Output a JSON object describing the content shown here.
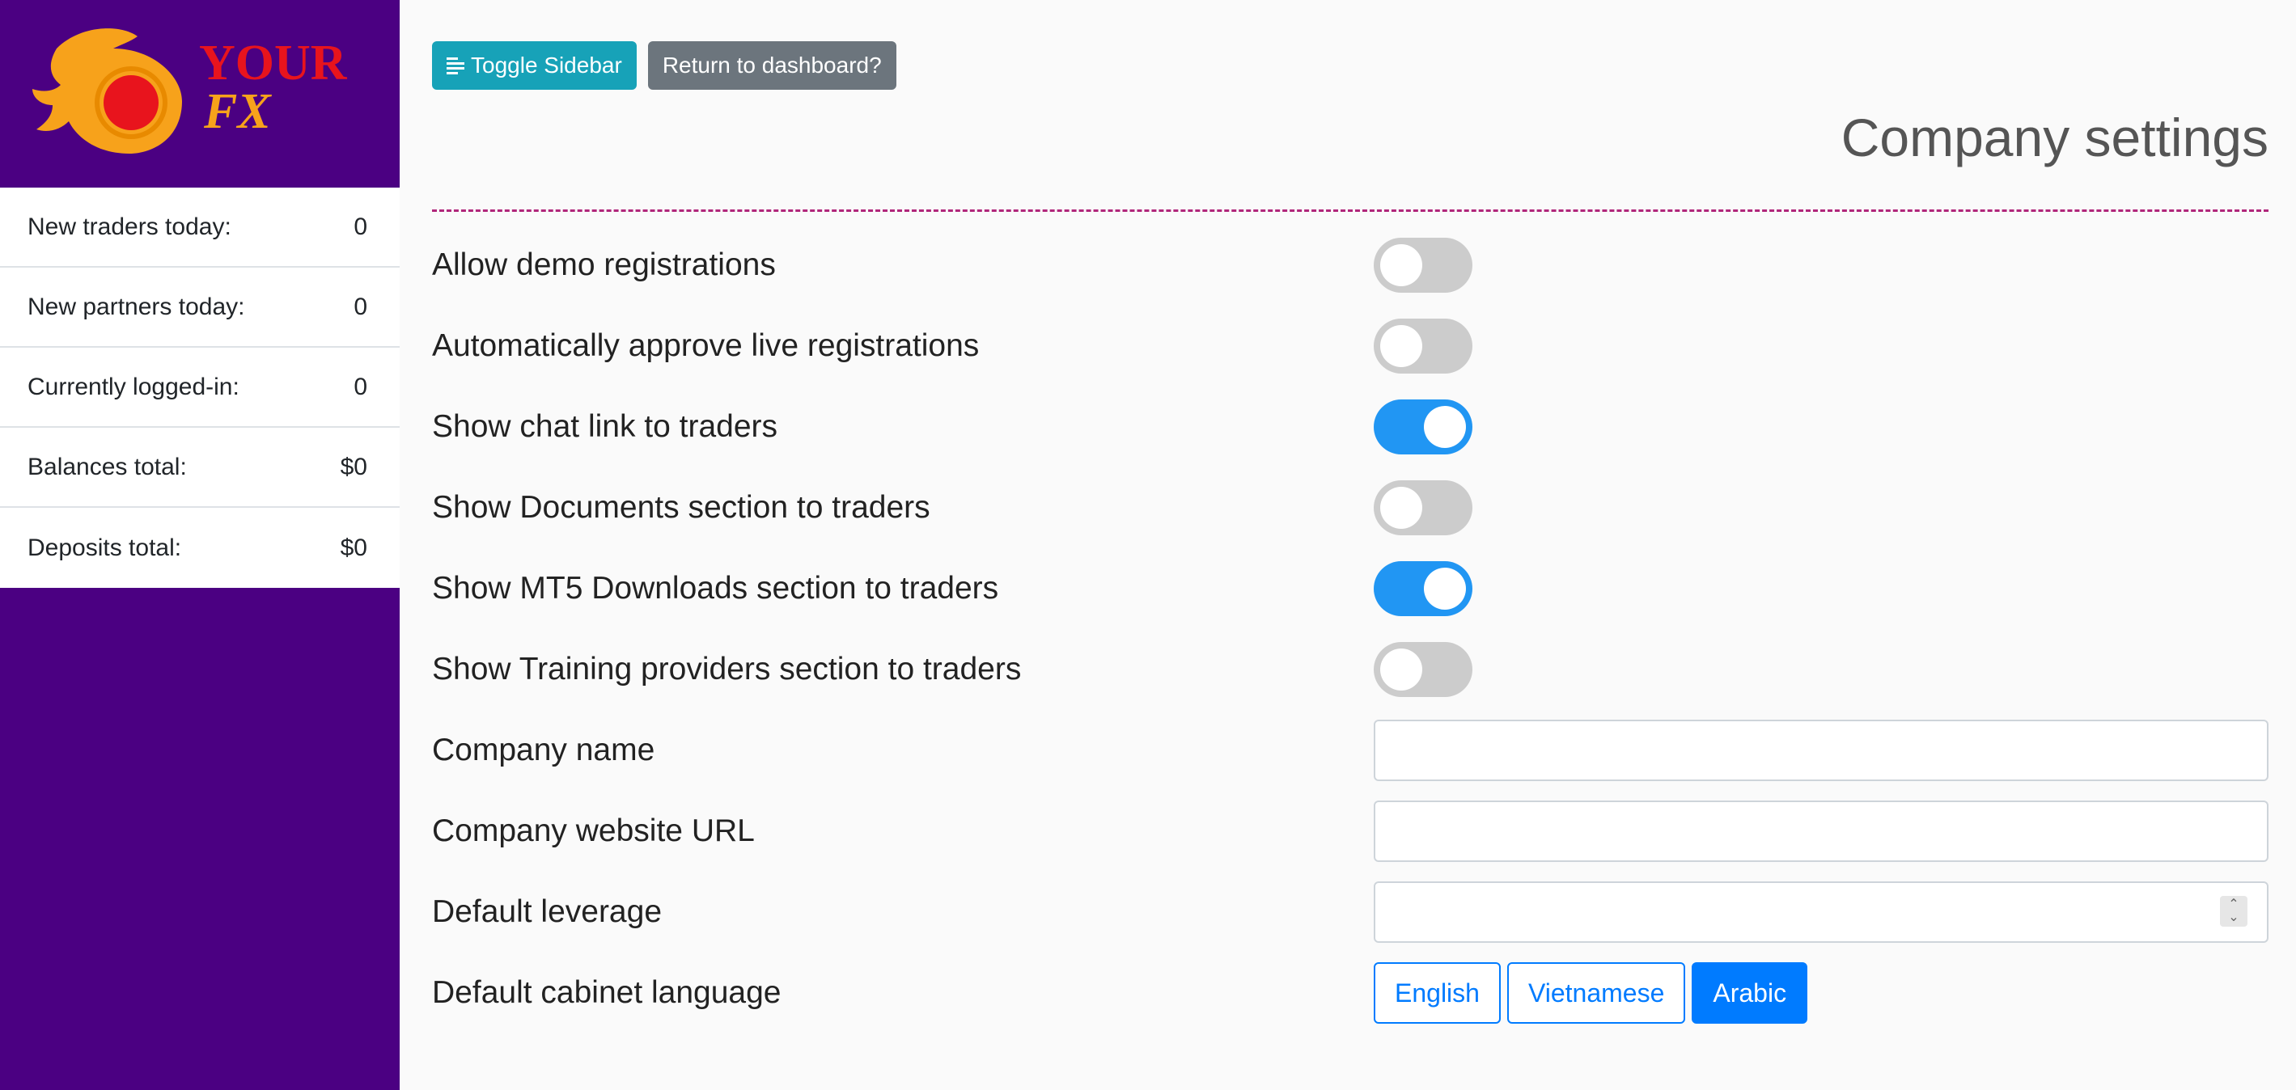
{
  "brand": {
    "logo_text_line1": "YOUR",
    "logo_text_line2": "FX",
    "colors": {
      "sidebar_bg": "#4b0082",
      "logo_orange": "#f7a21b",
      "logo_red": "#e8141d",
      "accent_blue": "#2196f3",
      "info": "#17a2b8",
      "secondary": "#6c757d",
      "primary": "#007bff"
    }
  },
  "sidebar": {
    "stats": [
      {
        "label": "New traders today:",
        "value": "0"
      },
      {
        "label": "New partners today:",
        "value": "0"
      },
      {
        "label": "Currently logged-in:",
        "value": "0"
      },
      {
        "label": "Balances total:",
        "value": "$0"
      },
      {
        "label": "Deposits total:",
        "value": "$0"
      }
    ]
  },
  "toolbar": {
    "toggle_sidebar_label": "Toggle Sidebar",
    "toggle_sidebar_icon": "menu-lines-icon",
    "return_label": "Return to dashboard?"
  },
  "page": {
    "title": "Company settings"
  },
  "settings": {
    "toggles": [
      {
        "label": "Allow demo registrations",
        "on": false
      },
      {
        "label": "Automatically approve live registrations",
        "on": false
      },
      {
        "label": "Show chat link to traders",
        "on": true
      },
      {
        "label": "Show Documents section to traders",
        "on": false
      },
      {
        "label": "Show MT5 Downloads section to traders",
        "on": true
      },
      {
        "label": "Show Training providers section to traders",
        "on": false
      }
    ],
    "company_name": {
      "label": "Company name",
      "value": ""
    },
    "company_website": {
      "label": "Company website URL",
      "value": ""
    },
    "default_leverage": {
      "label": "Default leverage",
      "value": ""
    },
    "default_language": {
      "label": "Default cabinet language",
      "options": [
        "English",
        "Vietnamese",
        "Arabic"
      ],
      "selected": "Arabic"
    }
  }
}
